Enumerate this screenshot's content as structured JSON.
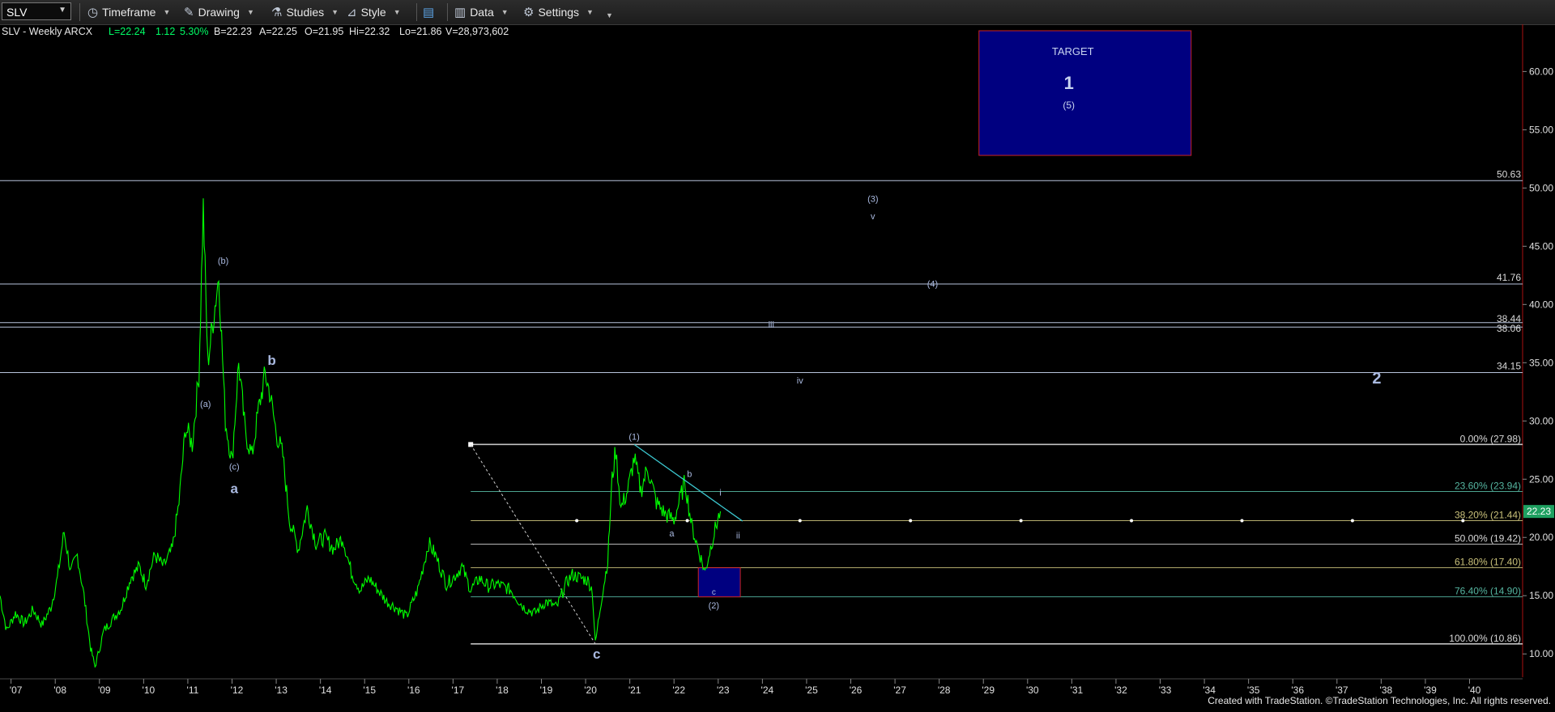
{
  "toolbar": {
    "symbol": "SLV",
    "timeframe": "Timeframe",
    "drawing": "Drawing",
    "studies": "Studies",
    "style": "Style",
    "data": "Data",
    "settings": "Settings"
  },
  "header": {
    "symbol_info": "SLV - Weekly  ARCX",
    "last": "L=22.24",
    "change": "1.12",
    "change_pct": "5.30%",
    "bid": "B=22.23",
    "ask": "A=22.25",
    "open": "O=21.95",
    "high": "Hi=22.32",
    "low": "Lo=21.86",
    "volume": "V=28,973,602"
  },
  "footer": "Created with TradeStation. ©TradeStation Technologies, Inc. All rights reserved.",
  "colors": {
    "price": "#00ff00",
    "level_line": "#b8c4dc",
    "fib_text_green": "#55b5a0",
    "fib_text_yellow": "#c9c07a",
    "fib_text_white": "#d0d0d0",
    "target_fill": "#000080",
    "target_border": "#cc2222",
    "current_price_badge": "#1ea060",
    "label": "#a9b9e0",
    "axis_line": "#aa1111"
  },
  "chart_data": {
    "type": "line",
    "title": "SLV - Weekly",
    "ylim": [
      8,
      65
    ],
    "xlim": [
      2006.75,
      2041.2
    ],
    "y_ticks": [
      "10.00",
      "15.00",
      "20.00",
      "25.00",
      "30.00",
      "35.00",
      "40.00",
      "45.00",
      "50.00",
      "55.00",
      "60.00"
    ],
    "x_ticks": [
      "'07",
      "'08",
      "'09",
      "'10",
      "'11",
      "'12",
      "'13",
      "'14",
      "'15",
      "'16",
      "'17",
      "'18",
      "'19",
      "'20",
      "'21",
      "'22",
      "'23",
      "'24",
      "'25",
      "'26",
      "'27",
      "'28",
      "'29",
      "'30",
      "'31",
      "'32",
      "'33",
      "'34",
      "'35",
      "'36",
      "'37",
      "'38",
      "'39",
      "'40"
    ],
    "price_series": {
      "name": "SLV",
      "points": [
        [
          2006.75,
          15.0
        ],
        [
          2006.9,
          12.0
        ],
        [
          2007.1,
          13.5
        ],
        [
          2007.3,
          12.6
        ],
        [
          2007.5,
          13.8
        ],
        [
          2007.7,
          12.5
        ],
        [
          2007.9,
          14.0
        ],
        [
          2008.05,
          16.5
        ],
        [
          2008.2,
          20.5
        ],
        [
          2008.35,
          17.0
        ],
        [
          2008.5,
          18.5
        ],
        [
          2008.65,
          15.0
        ],
        [
          2008.8,
          10.5
        ],
        [
          2008.9,
          8.9
        ],
        [
          2009.1,
          12.0
        ],
        [
          2009.3,
          13.0
        ],
        [
          2009.5,
          14.0
        ],
        [
          2009.7,
          16.5
        ],
        [
          2009.9,
          17.5
        ],
        [
          2010.05,
          16.0
        ],
        [
          2010.25,
          18.5
        ],
        [
          2010.45,
          17.5
        ],
        [
          2010.65,
          19.0
        ],
        [
          2010.8,
          23.0
        ],
        [
          2010.95,
          29.5
        ],
        [
          2011.1,
          28.0
        ],
        [
          2011.25,
          34.0
        ],
        [
          2011.35,
          48.3
        ],
        [
          2011.45,
          35.0
        ],
        [
          2011.55,
          38.0
        ],
        [
          2011.7,
          42.5
        ],
        [
          2011.85,
          30.0
        ],
        [
          2012.0,
          26.5
        ],
        [
          2012.15,
          35.0
        ],
        [
          2012.3,
          29.0
        ],
        [
          2012.45,
          27.0
        ],
        [
          2012.6,
          31.0
        ],
        [
          2012.75,
          34.0
        ],
        [
          2012.85,
          32.5
        ],
        [
          2013.0,
          29.0
        ],
        [
          2013.15,
          27.0
        ],
        [
          2013.3,
          21.5
        ],
        [
          2013.5,
          19.0
        ],
        [
          2013.7,
          22.5
        ],
        [
          2013.9,
          19.5
        ],
        [
          2014.1,
          20.0
        ],
        [
          2014.3,
          19.0
        ],
        [
          2014.5,
          20.0
        ],
        [
          2014.7,
          17.0
        ],
        [
          2014.9,
          15.5
        ],
        [
          2015.1,
          16.5
        ],
        [
          2015.3,
          15.5
        ],
        [
          2015.5,
          14.5
        ],
        [
          2015.7,
          14.0
        ],
        [
          2015.95,
          13.2
        ],
        [
          2016.2,
          15.5
        ],
        [
          2016.45,
          19.5
        ],
        [
          2016.6,
          18.5
        ],
        [
          2016.85,
          16.0
        ],
        [
          2017.0,
          16.5
        ],
        [
          2017.2,
          17.5
        ],
        [
          2017.4,
          15.5
        ],
        [
          2017.6,
          16.5
        ],
        [
          2017.8,
          15.8
        ],
        [
          2018.0,
          16.0
        ],
        [
          2018.3,
          15.5
        ],
        [
          2018.6,
          14.0
        ],
        [
          2018.85,
          13.5
        ],
        [
          2019.1,
          14.5
        ],
        [
          2019.35,
          14.0
        ],
        [
          2019.55,
          16.0
        ],
        [
          2019.7,
          16.8
        ],
        [
          2019.9,
          16.5
        ],
        [
          2020.05,
          16.3
        ],
        [
          2020.15,
          15.5
        ],
        [
          2020.22,
          10.86
        ],
        [
          2020.35,
          14.5
        ],
        [
          2020.5,
          18.0
        ],
        [
          2020.6,
          25.0
        ],
        [
          2020.68,
          27.5
        ],
        [
          2020.8,
          22.5
        ],
        [
          2020.95,
          24.0
        ],
        [
          2021.1,
          26.8
        ],
        [
          2021.25,
          24.0
        ],
        [
          2021.4,
          26.0
        ],
        [
          2021.6,
          23.0
        ],
        [
          2021.8,
          22.0
        ],
        [
          2022.0,
          21.5
        ],
        [
          2022.15,
          23.5
        ],
        [
          2022.25,
          24.8
        ],
        [
          2022.4,
          21.0
        ],
        [
          2022.55,
          19.0
        ],
        [
          2022.7,
          17.0
        ],
        [
          2022.85,
          19.5
        ],
        [
          2022.95,
          21.0
        ],
        [
          2023.05,
          22.24
        ]
      ]
    },
    "horizontal_levels": [
      {
        "value": 50.63,
        "label": "50.63"
      },
      {
        "value": 41.76,
        "label": "41.76"
      },
      {
        "value": 38.44,
        "label": "38.44"
      },
      {
        "value": 38.06,
        "label": "38.06"
      },
      {
        "value": 34.15,
        "label": "34.15"
      }
    ],
    "fib_levels": [
      {
        "value": 27.98,
        "label": "0.00% (27.98)",
        "color": "#d8d8d8"
      },
      {
        "value": 23.94,
        "label": "23.60% (23.94)",
        "color": "#55b5a0"
      },
      {
        "value": 21.44,
        "label": "38.20% (21.44)",
        "color": "#c9c07a"
      },
      {
        "value": 19.42,
        "label": "50.00% (19.42)",
        "color": "#d8d8d8"
      },
      {
        "value": 17.4,
        "label": "61.80% (17.40)",
        "color": "#c9c07a"
      },
      {
        "value": 14.9,
        "label": "76.40% (14.90)",
        "color": "#55b5a0"
      },
      {
        "value": 10.86,
        "label": "100.00% (10.86)",
        "color": "#d8d8d8"
      }
    ],
    "current_price": "22.23",
    "wave_labels": [
      {
        "text": "(b)",
        "x": 2011.8,
        "y": 43.5,
        "size": 11
      },
      {
        "text": "(a)",
        "x": 2011.4,
        "y": 31.2,
        "size": 11
      },
      {
        "text": "(c)",
        "x": 2012.05,
        "y": 25.8,
        "size": 11
      },
      {
        "text": "a",
        "x": 2012.05,
        "y": 23.8,
        "size": 17
      },
      {
        "text": "b",
        "x": 2012.9,
        "y": 34.8,
        "size": 17
      },
      {
        "text": "c",
        "x": 2020.25,
        "y": 9.6,
        "size": 17
      },
      {
        "text": "(1)",
        "x": 2021.1,
        "y": 28.4,
        "size": 11
      },
      {
        "text": "b",
        "x": 2022.35,
        "y": 25.2,
        "size": 11
      },
      {
        "text": "a",
        "x": 2021.95,
        "y": 20.1,
        "size": 11
      },
      {
        "text": "i",
        "x": 2023.05,
        "y": 23.6,
        "size": 11
      },
      {
        "text": "ii",
        "x": 2023.45,
        "y": 19.9,
        "size": 11
      },
      {
        "text": "c",
        "x": 2022.9,
        "y": 15.1,
        "size": 10
      },
      {
        "text": "(2)",
        "x": 2022.9,
        "y": 13.9,
        "size": 11
      },
      {
        "text": "iii",
        "x": 2024.2,
        "y": 38.0,
        "size": 11
      },
      {
        "text": "iv",
        "x": 2024.85,
        "y": 33.2,
        "size": 11
      },
      {
        "text": "(3)",
        "x": 2026.5,
        "y": 48.8,
        "size": 11
      },
      {
        "text": "v",
        "x": 2026.5,
        "y": 47.3,
        "size": 11
      },
      {
        "text": "(4)",
        "x": 2027.85,
        "y": 41.5,
        "size": 11
      },
      {
        "text": "2",
        "x": 2037.9,
        "y": 33.2,
        "size": 20
      }
    ],
    "target_box": {
      "title": "TARGET",
      "main": "1",
      "sub": "(5)",
      "x0": 2028.9,
      "x1": 2033.7,
      "y0": 52.8,
      "y1": 63.5
    },
    "support_box": {
      "x0": 2022.55,
      "x1": 2023.5,
      "y0": 14.9,
      "y1": 17.4
    },
    "trendline": {
      "x0": 2021.1,
      "y0": 27.98,
      "x1": 2023.55,
      "y1": 21.4
    },
    "dashed_line": {
      "x0": 2017.4,
      "y0": 27.98,
      "x1": 2020.22,
      "y1": 10.86
    },
    "fib_start_x": 2017.4,
    "dots": {
      "y": 21.44,
      "xs": [
        2019.8,
        2022.3,
        2024.85,
        2027.35,
        2029.85,
        2032.35,
        2034.85,
        2037.35,
        2039.85
      ]
    }
  }
}
